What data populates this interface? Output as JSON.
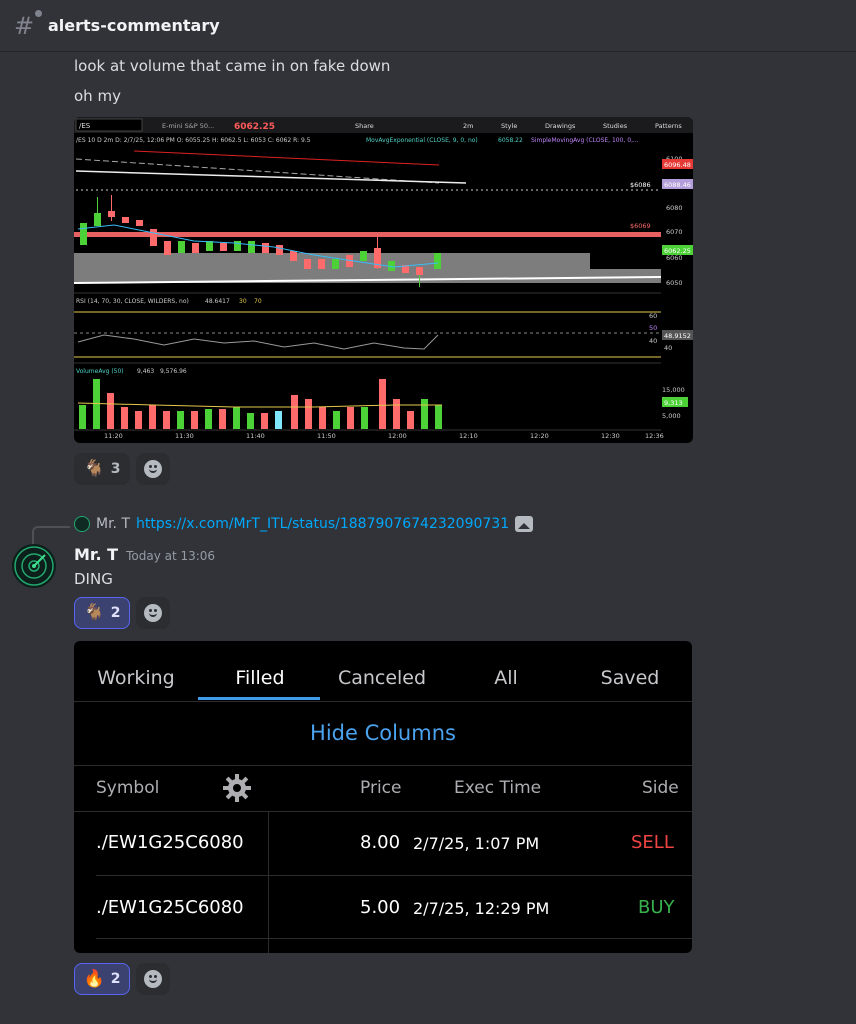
{
  "channel": {
    "name": "alerts-commentary"
  },
  "message1": {
    "lines": [
      "look at volume that came in on fake down",
      "oh my"
    ],
    "chart": {
      "symbol": "/ES",
      "contract": "E-mini S&P 50...",
      "last": "6062.25",
      "toolbar": {
        "share": "Share",
        "interval": "2m",
        "style": "Style",
        "drawings": "Drawings",
        "studies": "Studies",
        "patterns": "Patterns"
      },
      "ohlc": "/ES 10 D 2m  D: 2/7/25, 12:06 PM  O: 6055.25  H: 6062.5  L: 6053  C: 6062  R: 9.5",
      "ema_label": "MovAvgExponential (CLOSE, 9, 0, no)",
      "ema_value": "6058.22",
      "sma_label": "SimpleMovingAvg (CLOSE, 100, 0,...",
      "price_axis": [
        "6100",
        "6080",
        "6070",
        "6060",
        "6050"
      ],
      "price_tags": {
        "red": "6096.48",
        "purple": "6088.46",
        "green": "6062.25"
      },
      "levels": {
        "upper": "$6086",
        "red": "$6069"
      },
      "rsi_label": "RSI (14, 70, 30, CLOSE, WILDERS, no)",
      "rsi_value": "48.6417",
      "rsi_levels": [
        "30",
        "70"
      ],
      "rsi_axis": [
        "60",
        "50",
        "40"
      ],
      "rsi_tag": "48.9152",
      "vol_label": "VolumeAvg (50)",
      "vol_values": [
        "9,463",
        "9,576.96"
      ],
      "vol_axis": [
        "15,000",
        "5,000"
      ],
      "vol_tag": "9,313",
      "time_axis": [
        "11:20",
        "11:30",
        "11:40",
        "11:50",
        "12:00",
        "12:10",
        "12:20",
        "12:30",
        "12:36"
      ]
    },
    "reactions": [
      {
        "emoji": "🐐",
        "count": "3"
      }
    ]
  },
  "message2": {
    "reply": {
      "name": "Mr. T",
      "link": "https://x.com/MrT_ITL/status/1887907674232090731"
    },
    "author": "Mr. T",
    "timestamp": "Today at 13:06",
    "text": "DING",
    "reactions": [
      {
        "emoji": "🐐",
        "count": "2"
      }
    ],
    "orders": {
      "tabs": [
        "Working",
        "Filled",
        "Canceled",
        "All",
        "Saved"
      ],
      "active_tab": "Filled",
      "hide_columns": "Hide Columns",
      "columns": {
        "symbol": "Symbol",
        "price": "Price",
        "exec_time": "Exec Time",
        "side": "Side"
      },
      "rows": [
        {
          "symbol": "./EW1G25C6080",
          "price": "8.00",
          "exec_time": "2/7/25, 1:07 PM",
          "side": "SELL"
        },
        {
          "symbol": "./EW1G25C6080",
          "price": "5.00",
          "exec_time": "2/7/25, 12:29 PM",
          "side": "BUY"
        }
      ]
    },
    "reactions_after": [
      {
        "emoji": "🔥",
        "count": "2"
      }
    ]
  }
}
